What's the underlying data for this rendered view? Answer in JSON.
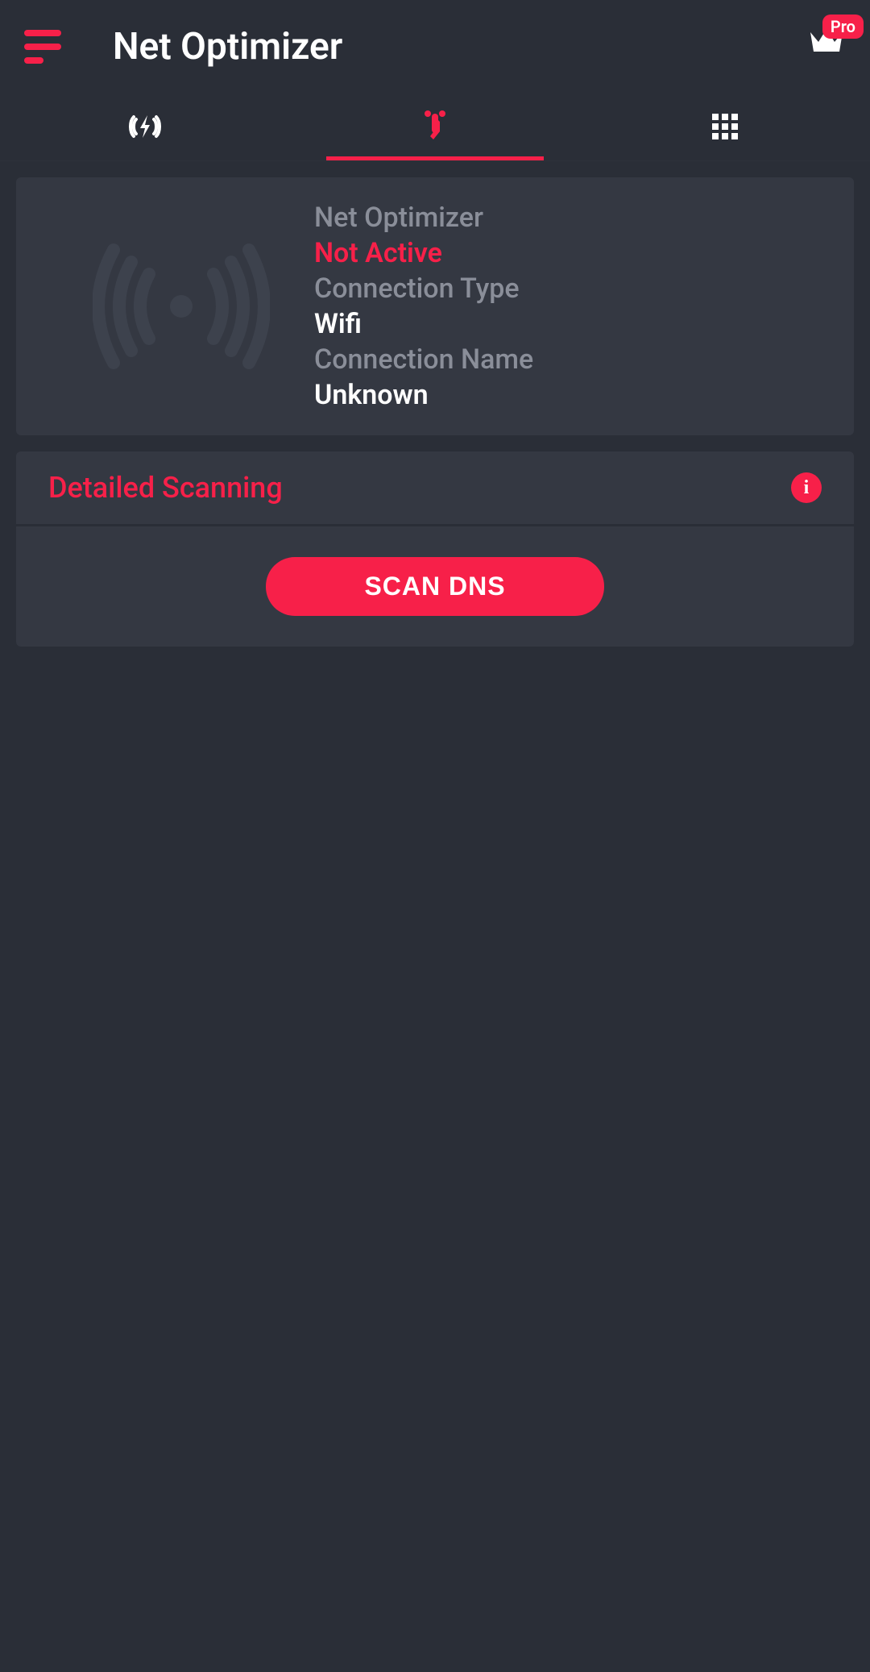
{
  "header": {
    "title": "Net Optimizer",
    "pro_label": "Pro"
  },
  "status": {
    "app_label": "Net Optimizer",
    "status_value": "Not Active",
    "conn_type_label": "Connection Type",
    "conn_type_value": "Wifi",
    "conn_name_label": "Connection Name",
    "conn_name_value": "Unknown"
  },
  "scan": {
    "section_title": "Detailed Scanning",
    "button_label": "SCAN DNS"
  },
  "colors": {
    "accent": "#f72049",
    "bg": "#2a2e37",
    "card": "#343842",
    "muted": "#8a8e99"
  }
}
